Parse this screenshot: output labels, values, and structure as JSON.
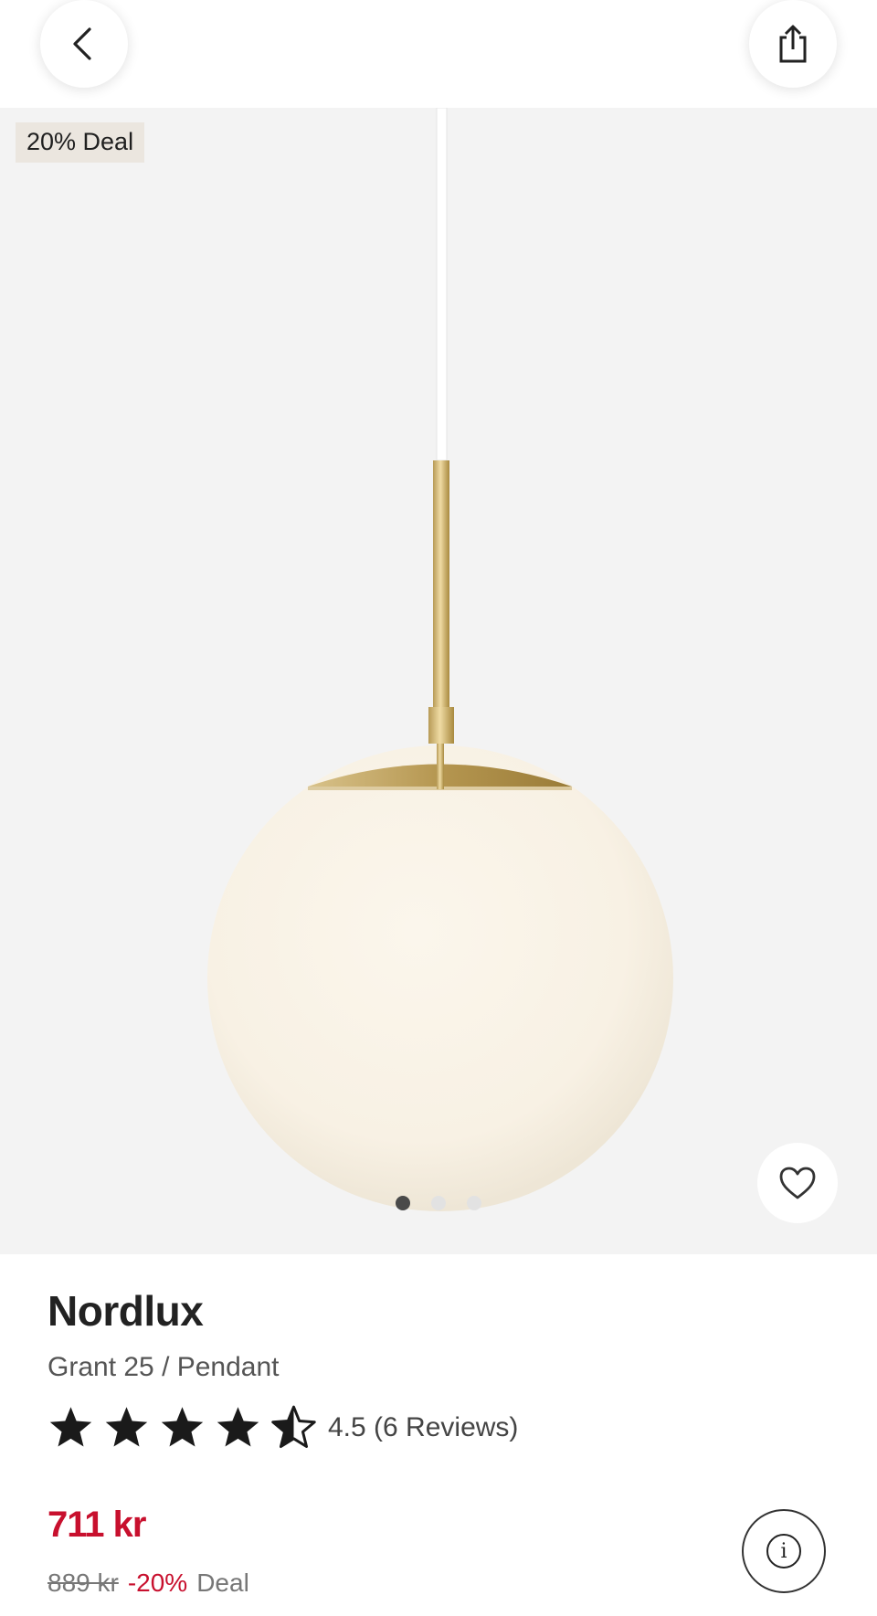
{
  "header": {
    "back_icon": "chevron-left-icon",
    "share_icon": "share-icon"
  },
  "gallery": {
    "badge": "20% Deal",
    "dots_total": 3,
    "active_dot": 1,
    "favorite_icon": "heart-outline-icon"
  },
  "product": {
    "brand": "Nordlux",
    "model": "Grant 25 / Pendant",
    "rating_value": 4.5,
    "rating_text": "4.5 (6 Reviews)",
    "price": "711 kr",
    "old_price": "889 kr",
    "discount": "-20%",
    "deal_label": "Deal"
  },
  "colors": {
    "accent_red": "#c8102e",
    "hero_bg": "#f3f3f3",
    "badge_bg": "#ebe6df"
  }
}
